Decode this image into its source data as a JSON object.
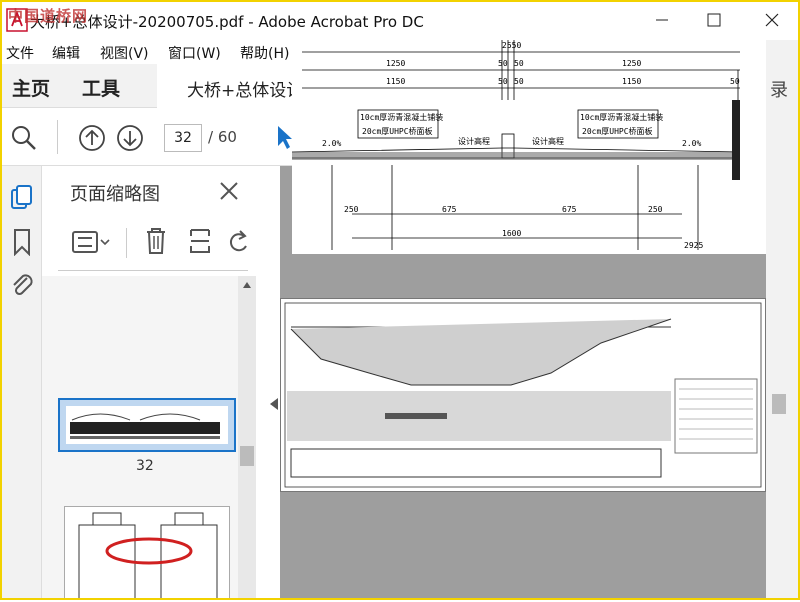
{
  "window": {
    "title": "大桥+总体设计-20200705.pdf - Adobe Acrobat Pro DC",
    "watermark": "中国道桥网"
  },
  "menus": [
    "文件",
    "编辑",
    "视图(V)",
    "窗口(W)",
    "帮助(H)"
  ],
  "nav": {
    "home": "主页",
    "tools": "工具",
    "doc_tab": "大桥+总体设计"
  },
  "toolbar": {
    "page_current": "32",
    "page_total": "/ 60"
  },
  "thumbnails": {
    "panel_title": "页面缩略图",
    "items": [
      {
        "label": "32"
      }
    ]
  },
  "right_strip": {
    "partial_label": "录"
  },
  "drawing": {
    "dims_top": [
      "2550",
      "1250",
      "50",
      "50",
      "1250",
      "1150",
      "50",
      "50",
      "1150",
      "50"
    ],
    "dims_bottom": [
      "250",
      "675",
      "675",
      "250",
      "1600",
      "2925"
    ],
    "labels": [
      "10cm厚沥青混凝土铺装",
      "20cm厚UHPC桥面板",
      "10cm厚沥青混凝土铺装",
      "20cm厚UHPC桥面板",
      "设计高程",
      "设计高程",
      "2.0%",
      "2.0%"
    ]
  },
  "colors": {
    "accent": "#1a73c8",
    "window_border": "#f2d200",
    "annotation": "#d02020"
  },
  "icons": [
    "acrobat-logo-icon",
    "minimize-icon",
    "maximize-icon",
    "close-icon",
    "search-icon",
    "page-up-icon",
    "page-down-icon",
    "select-cursor-icon",
    "page-thumbnails-icon",
    "bookmark-icon",
    "attachment-icon",
    "thumbnail-options-icon",
    "delete-icon",
    "extract-icon",
    "rotate-icon"
  ]
}
